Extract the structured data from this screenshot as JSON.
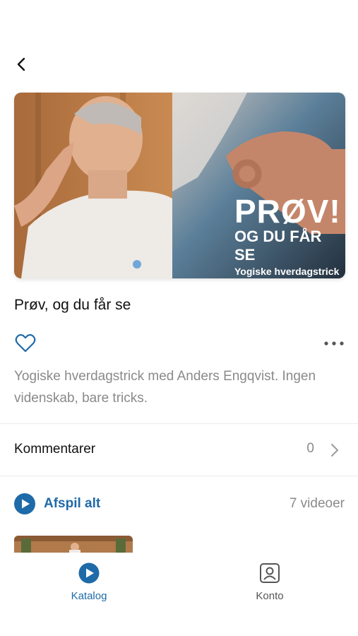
{
  "nav": {
    "back_icon": "chevron-left-icon"
  },
  "hero": {
    "headline": "PRØV!",
    "subheadline": "OG DU FÅR SE",
    "caption": "Yogiske hverdagstrick"
  },
  "title": "Prøv, og du får se",
  "actions": {
    "favorite_icon": "heart-icon",
    "more_icon": "more-horizontal-icon"
  },
  "description": "Yogiske hverdagstrick med Anders Engqvist. Ingen videnskab, bare tricks.",
  "comments": {
    "label": "Kommentarer",
    "count": "0"
  },
  "playlist": {
    "play_all_label": "Afspil alt",
    "video_count": "7 videoer"
  },
  "tabs": [
    {
      "label": "Katalog",
      "icon": "play-circle-icon",
      "active": true
    },
    {
      "label": "Konto",
      "icon": "account-icon",
      "active": false
    }
  ],
  "colors": {
    "accent": "#1f6aa8",
    "muted_text": "#8a8a8a",
    "divider": "#ececec"
  }
}
